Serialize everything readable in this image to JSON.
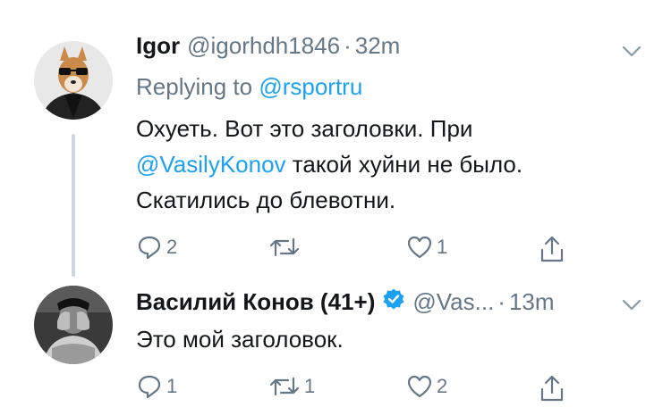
{
  "tweets": [
    {
      "name": "Igor",
      "handle": "@igorhdh1846",
      "dot": "·",
      "time": "32m",
      "replying_prefix": "Replying to ",
      "replying_to": "@rsportru",
      "text_line1": "Охуеть. Вот это заголовки. При",
      "text_mention": "@VasilyKonov",
      "text_line2_rest": " такой хуйни не было.",
      "text_line3": "Скатились до блевотни.",
      "actions": {
        "reply": "2",
        "retweet": "",
        "like": "1"
      }
    },
    {
      "name": "Василий Конов (41+)",
      "handle": "@Vas...",
      "dot": "·",
      "time": "13m",
      "text_line1": "Это мой заголовок.",
      "actions": {
        "reply": "1",
        "retweet": "1",
        "like": "2"
      }
    }
  ],
  "colors": {
    "text": "#14171a",
    "secondary": "#657786",
    "link": "#1da1f2",
    "thread_line": "#ccd6dd"
  },
  "icons": [
    "chevron-down-icon",
    "reply-icon",
    "retweet-icon",
    "like-icon",
    "share-icon",
    "verified-badge-icon"
  ]
}
